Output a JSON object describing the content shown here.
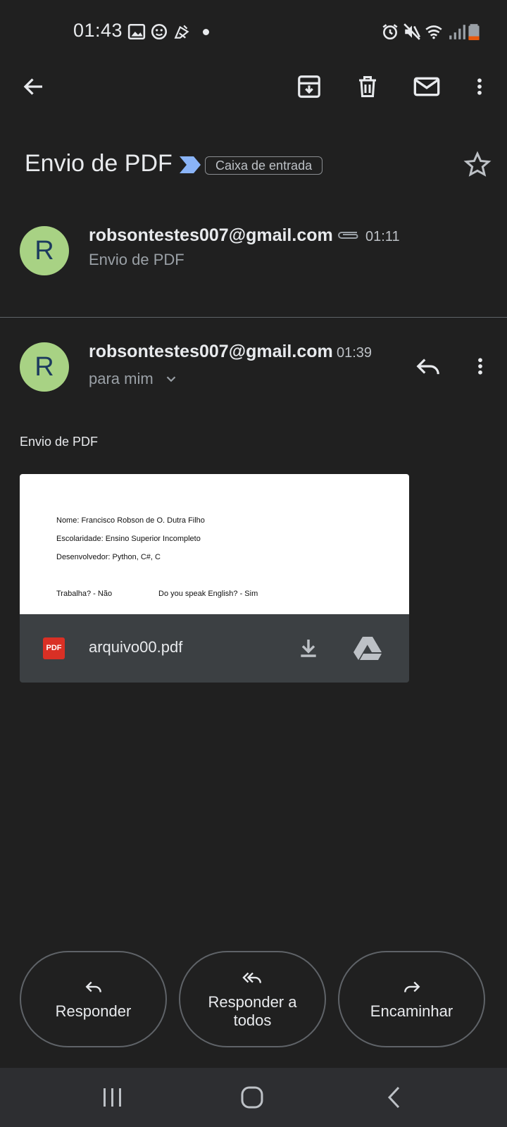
{
  "status_bar": {
    "time": "01:43",
    "left_icons": [
      "image-icon",
      "sync-face-icon",
      "notification-icon",
      "dot-icon"
    ],
    "right_icons": [
      "alarm-icon",
      "mute-icon",
      "wifi-icon",
      "signal-icon",
      "battery-icon"
    ]
  },
  "toolbar": {
    "icons": [
      "back-arrow-icon",
      "archive-icon",
      "delete-icon",
      "mark-unread-icon",
      "more-vert-icon"
    ]
  },
  "thread": {
    "subject": "Envio de PDF",
    "label": "Caixa de entrada",
    "important_color": "#8ab4f8"
  },
  "messages": [
    {
      "avatar_letter": "R",
      "sender": "robsontestes007@gmail.com",
      "time": "01:11",
      "snippet": "Envio de PDF"
    },
    {
      "avatar_letter": "R",
      "sender": "robsontestes007@gmail.com",
      "time": "01:39",
      "recipient": "para mim",
      "body": "Envio de PDF"
    }
  ],
  "attachment": {
    "filename": "arquivo00.pdf",
    "preview_lines": [
      "Nome: Francisco Robson de O. Dutra Filho",
      "Escolaridade: Ensino Superior Incompleto",
      "Desenvolvedor: Python, C#, C",
      "Trabalha? - Não",
      "Do you speak English? - Sim"
    ]
  },
  "actions": {
    "reply": "Responder",
    "reply_all_line1": "Responder a",
    "reply_all_line2": "todos",
    "forward": "Encaminhar"
  },
  "colors": {
    "background": "#202020",
    "avatar": "#a8d284",
    "pdf_badge": "#d93025"
  }
}
